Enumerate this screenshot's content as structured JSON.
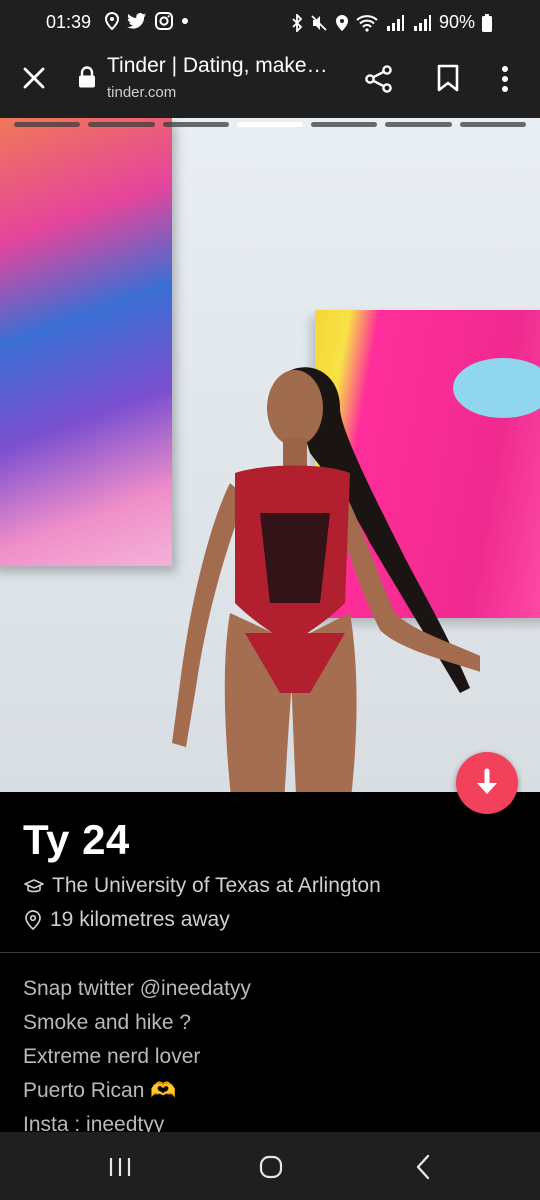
{
  "status_bar": {
    "time": "01:39",
    "battery": "90%"
  },
  "browser": {
    "page_title": "Tinder | Dating, make…",
    "url": "tinder.com"
  },
  "photo": {
    "total_photos": 7,
    "active_photo_index": 3
  },
  "profile": {
    "name_age": "Ty 24",
    "school": "The University of Texas at Arlington",
    "distance": "19 kilometres away",
    "bio_lines": [
      "Snap twitter @ineedatyy",
      "Smoke and hike ?",
      "Extreme nerd lover",
      "Puerto Rican 🫶",
      "Insta : ineedtyy"
    ]
  },
  "colors": {
    "accent": "#f2425b",
    "background": "#000000",
    "bar": "#1f1f1f"
  }
}
